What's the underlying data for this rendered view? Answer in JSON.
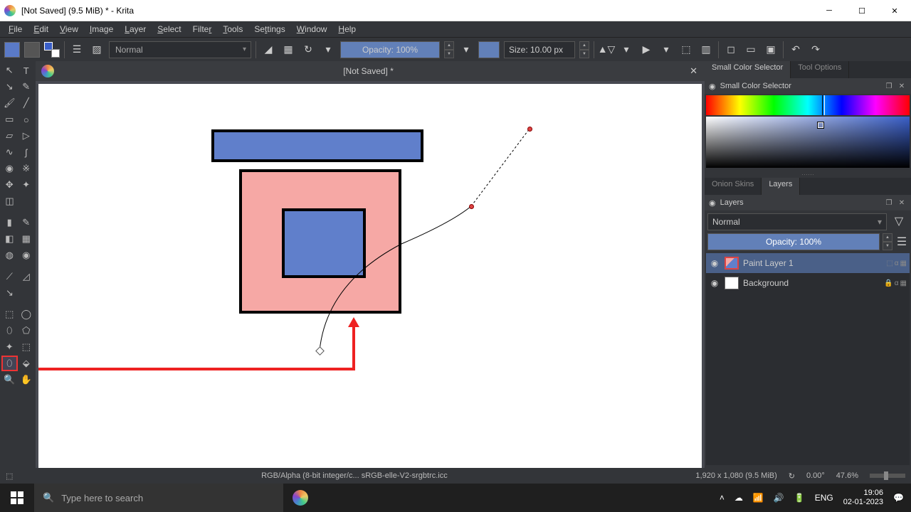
{
  "window": {
    "title": "[Not Saved]  (9.5 MiB)  * - Krita"
  },
  "menus": [
    "File",
    "Edit",
    "View",
    "Image",
    "Layer",
    "Select",
    "Filter",
    "Tools",
    "Settings",
    "Window",
    "Help"
  ],
  "toolbar": {
    "blend_mode": "Normal",
    "opacity": "Opacity: 100%",
    "size": "Size: 10.00 px"
  },
  "doc_tab": {
    "name": "[Not Saved]  *"
  },
  "right": {
    "tabs_top": [
      "Small Color Selector",
      "Tool Options"
    ],
    "panel_title": "Small Color Selector",
    "tabs_mid": [
      "Onion Skins",
      "Layers"
    ],
    "layers_title": "Layers",
    "layers_blend": "Normal",
    "layers_opacity": "Opacity:  100%",
    "layers": [
      {
        "name": "Paint Layer 1",
        "selected": true
      },
      {
        "name": "Background",
        "selected": false
      }
    ]
  },
  "status": {
    "color_info": "RGB/Alpha (8-bit integer/c...   sRGB-elle-V2-srgbtrc.icc",
    "dims": "1,920 x 1,080 (9.5 MiB)",
    "angle": "0.00°",
    "zoom": "47.6%"
  },
  "taskbar": {
    "search_placeholder": "Type here to search",
    "lang": "ENG",
    "time": "19:06",
    "date": "02-01-2023"
  }
}
